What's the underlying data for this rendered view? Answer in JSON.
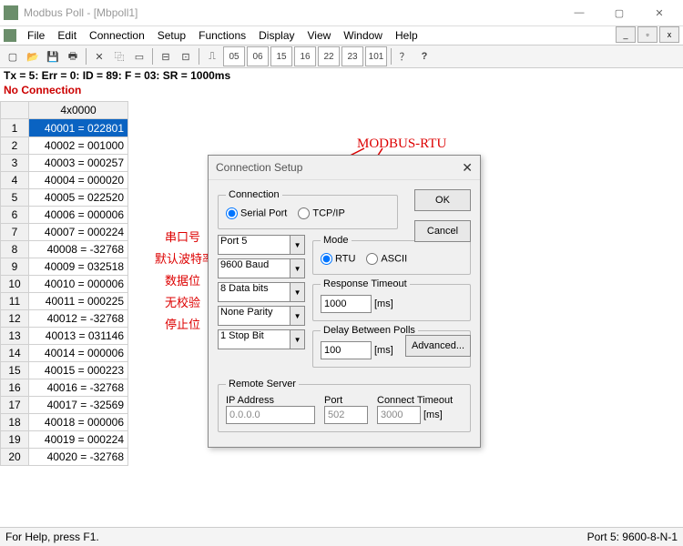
{
  "window": {
    "title": "Modbus Poll - [Mbpoll1]"
  },
  "menu": {
    "items": [
      "File",
      "Edit",
      "Connection",
      "Setup",
      "Functions",
      "Display",
      "View",
      "Window",
      "Help"
    ]
  },
  "toolbar_numbers": [
    "05",
    "06",
    "15",
    "16",
    "22",
    "23",
    "101"
  ],
  "status_line": "Tx = 5: Err = 0: ID = 89: F = 03: SR = 1000ms",
  "no_connection": "No Connection",
  "grid": {
    "header": "4x0000",
    "rows": [
      "40001 = 022801",
      "40002 = 001000",
      "40003 = 000257",
      "40004 = 000020",
      "40005 = 022520",
      "40006 = 000006",
      "40007 = 000224",
      "40008 = -32768",
      "40009 = 032518",
      "40010 = 000006",
      "40011 = 000225",
      "40012 = -32768",
      "40013 = 031146",
      "40014 = 000006",
      "40015 = 000223",
      "40016 = -32768",
      "40017 = -32569",
      "40018 = 000006",
      "40019 = 000224",
      "40020 = -32768"
    ],
    "selected": 0
  },
  "dialog": {
    "title": "Connection Setup",
    "connection_legend": "Connection",
    "serial_label": "Serial Port",
    "tcp_label": "TCP/IP",
    "mode_legend": "Mode",
    "rtu_label": "RTU",
    "ascii_label": "ASCII",
    "port": "Port 5",
    "baud": "9600 Baud",
    "databits": "8 Data bits",
    "parity": "None Parity",
    "stopbit": "1 Stop Bit",
    "resp_label": "Response Timeout",
    "resp_val": "1000",
    "delay_label": "Delay Between Polls",
    "delay_val": "100",
    "ms": "[ms]",
    "remote_legend": "Remote Server",
    "ip_label": "IP Address",
    "ip_val": "0.0.0.0",
    "port_label": "Port",
    "port_val": "502",
    "cto_label": "Connect Timeout",
    "cto_val": "3000",
    "ok": "OK",
    "cancel": "Cancel",
    "advanced": "Advanced..."
  },
  "annotations": {
    "title": "MODBUS-RTU",
    "a1": "串口号",
    "a2": "默认波特率",
    "a3": "数据位",
    "a4": "无校验",
    "a5": "停止位"
  },
  "statusbar": {
    "left": "For Help, press F1.",
    "right": "Port 5: 9600-8-N-1"
  }
}
